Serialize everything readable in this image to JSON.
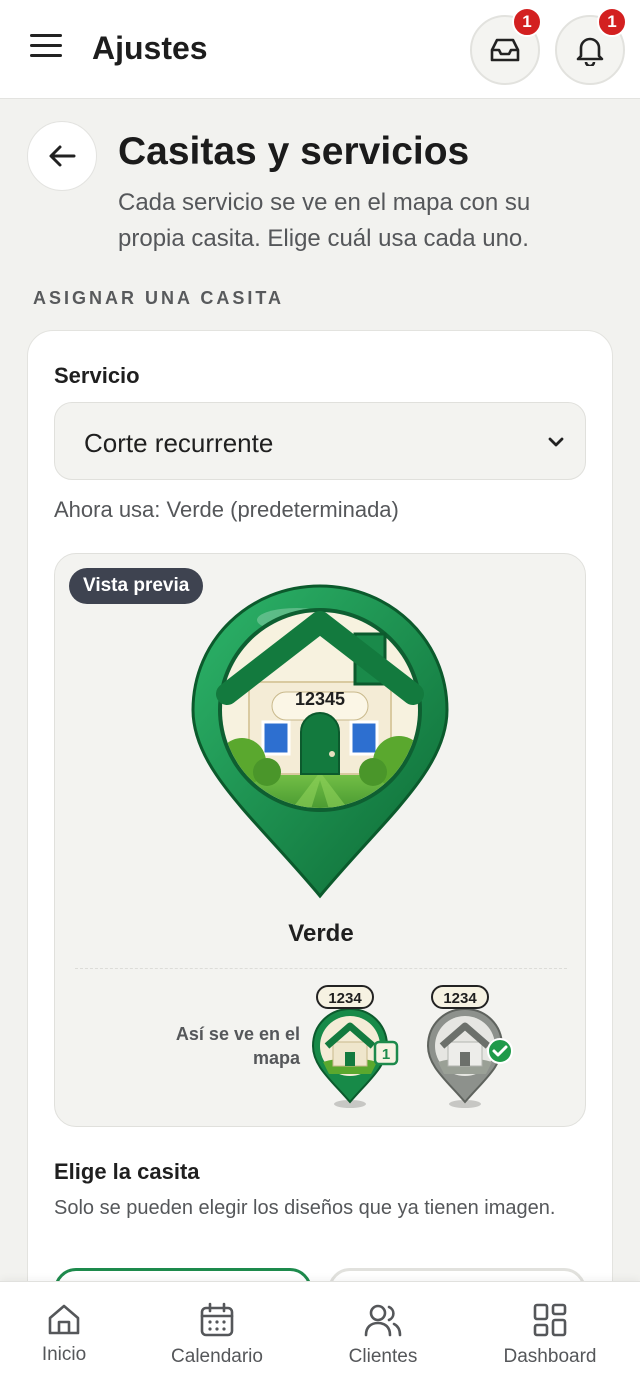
{
  "header": {
    "title": "Ajustes",
    "menu_icon": "hamburger-menu-icon",
    "inbox": {
      "icon": "inbox-icon",
      "badge": "1"
    },
    "notifications": {
      "icon": "bell-icon",
      "badge": "1"
    }
  },
  "page": {
    "title": "Casitas y servicios",
    "subtitle": "Cada servicio se ve en el mapa con su propia casita. Elige cuál usa cada uno.",
    "back_icon": "arrow-left-icon"
  },
  "assign_section": {
    "label": "ASIGNAR UNA CASITA",
    "service_label": "Servicio",
    "service_selected": "Corte recurrente",
    "current_use": "Ahora usa: Verde (predeterminada)"
  },
  "preview": {
    "tag": "Vista previa",
    "house_number": "12345",
    "name": "Verde",
    "map_label": "Así se ve en el mapa",
    "mini_pins": [
      {
        "number": "1234",
        "badge": "1",
        "style": "green"
      },
      {
        "number": "1234",
        "badge": "check",
        "style": "gray"
      }
    ]
  },
  "choose": {
    "title": "Elige la casita",
    "description": "Solo se pueden elegir los diseños que ya tienen imagen."
  },
  "colors": {
    "accent_green": "#1d8a4c",
    "badge_red": "#d32020",
    "tag_dark": "#3e4350"
  },
  "bottom_nav": [
    {
      "label": "Inicio",
      "icon": "home-icon"
    },
    {
      "label": "Calendario",
      "icon": "calendar-icon"
    },
    {
      "label": "Clientes",
      "icon": "users-icon"
    },
    {
      "label": "Dashboard",
      "icon": "dashboard-icon"
    }
  ]
}
